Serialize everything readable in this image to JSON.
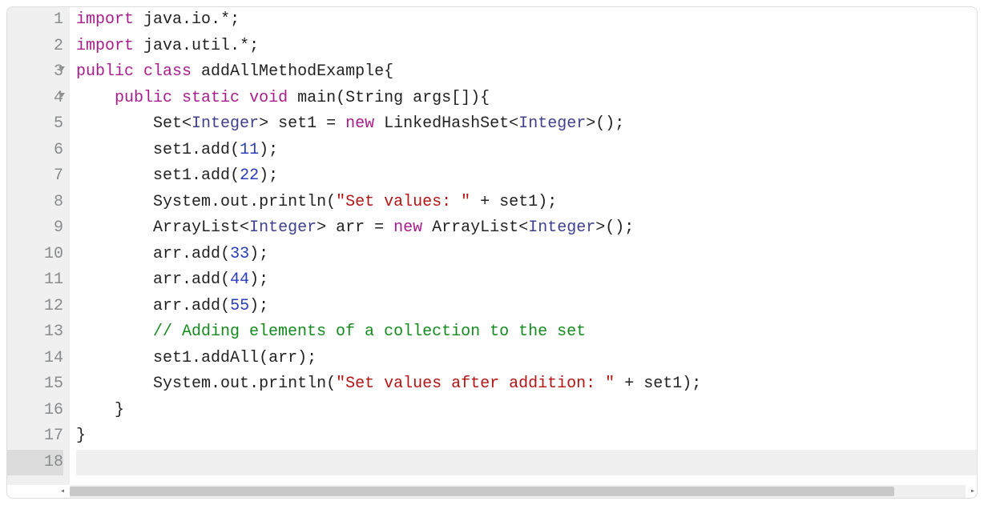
{
  "lineNumbers": [
    "1",
    "2",
    "3",
    "4",
    "5",
    "6",
    "7",
    "8",
    "9",
    "10",
    "11",
    "12",
    "13",
    "14",
    "15",
    "16",
    "17",
    "18"
  ],
  "foldLines": [
    3,
    4
  ],
  "activeLine": 18,
  "tokens": {
    "l1": [
      {
        "t": "import",
        "c": "kw"
      },
      {
        "t": " java",
        "c": "id"
      },
      {
        "t": ".",
        "c": "punc"
      },
      {
        "t": "io",
        "c": "id"
      },
      {
        "t": ".*;",
        "c": "punc"
      }
    ],
    "l2": [
      {
        "t": "import",
        "c": "kw"
      },
      {
        "t": " java",
        "c": "id"
      },
      {
        "t": ".",
        "c": "punc"
      },
      {
        "t": "util",
        "c": "id"
      },
      {
        "t": ".*;",
        "c": "punc"
      }
    ],
    "l3": [
      {
        "t": "public",
        "c": "kw"
      },
      {
        "t": " ",
        "c": "id"
      },
      {
        "t": "class",
        "c": "kw"
      },
      {
        "t": " addAllMethodExample",
        "c": "id"
      },
      {
        "t": "{",
        "c": "punc"
      }
    ],
    "l4": [
      {
        "t": "    ",
        "c": "id"
      },
      {
        "t": "public",
        "c": "kw"
      },
      {
        "t": " ",
        "c": "id"
      },
      {
        "t": "static",
        "c": "kw"
      },
      {
        "t": " ",
        "c": "id"
      },
      {
        "t": "void",
        "c": "kw"
      },
      {
        "t": " main",
        "c": "id"
      },
      {
        "t": "(",
        "c": "punc"
      },
      {
        "t": "String",
        "c": "id"
      },
      {
        "t": " args",
        "c": "id"
      },
      {
        "t": "[]){",
        "c": "punc"
      }
    ],
    "l5": [
      {
        "t": "        Set",
        "c": "id"
      },
      {
        "t": "<",
        "c": "punc"
      },
      {
        "t": "Integer",
        "c": "typ"
      },
      {
        "t": ">",
        "c": "punc"
      },
      {
        "t": " set1 ",
        "c": "id"
      },
      {
        "t": "=",
        "c": "op"
      },
      {
        "t": " ",
        "c": "id"
      },
      {
        "t": "new",
        "c": "kw"
      },
      {
        "t": " LinkedHashSet",
        "c": "id"
      },
      {
        "t": "<",
        "c": "punc"
      },
      {
        "t": "Integer",
        "c": "typ"
      },
      {
        "t": ">();",
        "c": "punc"
      }
    ],
    "l6": [
      {
        "t": "        set1",
        "c": "id"
      },
      {
        "t": ".",
        "c": "punc"
      },
      {
        "t": "add",
        "c": "id"
      },
      {
        "t": "(",
        "c": "punc"
      },
      {
        "t": "11",
        "c": "num"
      },
      {
        "t": ");",
        "c": "punc"
      }
    ],
    "l7": [
      {
        "t": "        set1",
        "c": "id"
      },
      {
        "t": ".",
        "c": "punc"
      },
      {
        "t": "add",
        "c": "id"
      },
      {
        "t": "(",
        "c": "punc"
      },
      {
        "t": "22",
        "c": "num"
      },
      {
        "t": ");",
        "c": "punc"
      }
    ],
    "l8": [
      {
        "t": "        System",
        "c": "id"
      },
      {
        "t": ".",
        "c": "punc"
      },
      {
        "t": "out",
        "c": "id"
      },
      {
        "t": ".",
        "c": "punc"
      },
      {
        "t": "println",
        "c": "id"
      },
      {
        "t": "(",
        "c": "punc"
      },
      {
        "t": "\"Set values: \"",
        "c": "str"
      },
      {
        "t": " ",
        "c": "id"
      },
      {
        "t": "+",
        "c": "op"
      },
      {
        "t": " set1",
        "c": "id"
      },
      {
        "t": ");",
        "c": "punc"
      }
    ],
    "l9": [
      {
        "t": "        ArrayList",
        "c": "id"
      },
      {
        "t": "<",
        "c": "punc"
      },
      {
        "t": "Integer",
        "c": "typ"
      },
      {
        "t": ">",
        "c": "punc"
      },
      {
        "t": " arr ",
        "c": "id"
      },
      {
        "t": "=",
        "c": "op"
      },
      {
        "t": " ",
        "c": "id"
      },
      {
        "t": "new",
        "c": "kw"
      },
      {
        "t": " ArrayList",
        "c": "id"
      },
      {
        "t": "<",
        "c": "punc"
      },
      {
        "t": "Integer",
        "c": "typ"
      },
      {
        "t": ">();",
        "c": "punc"
      }
    ],
    "l10": [
      {
        "t": "        arr",
        "c": "id"
      },
      {
        "t": ".",
        "c": "punc"
      },
      {
        "t": "add",
        "c": "id"
      },
      {
        "t": "(",
        "c": "punc"
      },
      {
        "t": "33",
        "c": "num"
      },
      {
        "t": ");",
        "c": "punc"
      }
    ],
    "l11": [
      {
        "t": "        arr",
        "c": "id"
      },
      {
        "t": ".",
        "c": "punc"
      },
      {
        "t": "add",
        "c": "id"
      },
      {
        "t": "(",
        "c": "punc"
      },
      {
        "t": "44",
        "c": "num"
      },
      {
        "t": ");",
        "c": "punc"
      }
    ],
    "l12": [
      {
        "t": "        arr",
        "c": "id"
      },
      {
        "t": ".",
        "c": "punc"
      },
      {
        "t": "add",
        "c": "id"
      },
      {
        "t": "(",
        "c": "punc"
      },
      {
        "t": "55",
        "c": "num"
      },
      {
        "t": ");",
        "c": "punc"
      }
    ],
    "l13": [
      {
        "t": "        ",
        "c": "id"
      },
      {
        "t": "// Adding elements of a collection to the set",
        "c": "cmt"
      }
    ],
    "l14": [
      {
        "t": "        set1",
        "c": "id"
      },
      {
        "t": ".",
        "c": "punc"
      },
      {
        "t": "addAll",
        "c": "id"
      },
      {
        "t": "(",
        "c": "punc"
      },
      {
        "t": "arr",
        "c": "id"
      },
      {
        "t": ");",
        "c": "punc"
      }
    ],
    "l15": [
      {
        "t": "        System",
        "c": "id"
      },
      {
        "t": ".",
        "c": "punc"
      },
      {
        "t": "out",
        "c": "id"
      },
      {
        "t": ".",
        "c": "punc"
      },
      {
        "t": "println",
        "c": "id"
      },
      {
        "t": "(",
        "c": "punc"
      },
      {
        "t": "\"Set values after addition: \"",
        "c": "str"
      },
      {
        "t": " ",
        "c": "id"
      },
      {
        "t": "+",
        "c": "op"
      },
      {
        "t": " set1",
        "c": "id"
      },
      {
        "t": ");",
        "c": "punc"
      }
    ],
    "l16": [
      {
        "t": "    }",
        "c": "punc"
      }
    ],
    "l17": [
      {
        "t": "}",
        "c": "punc"
      }
    ],
    "l18": [
      {
        "t": "",
        "c": "id"
      }
    ]
  }
}
